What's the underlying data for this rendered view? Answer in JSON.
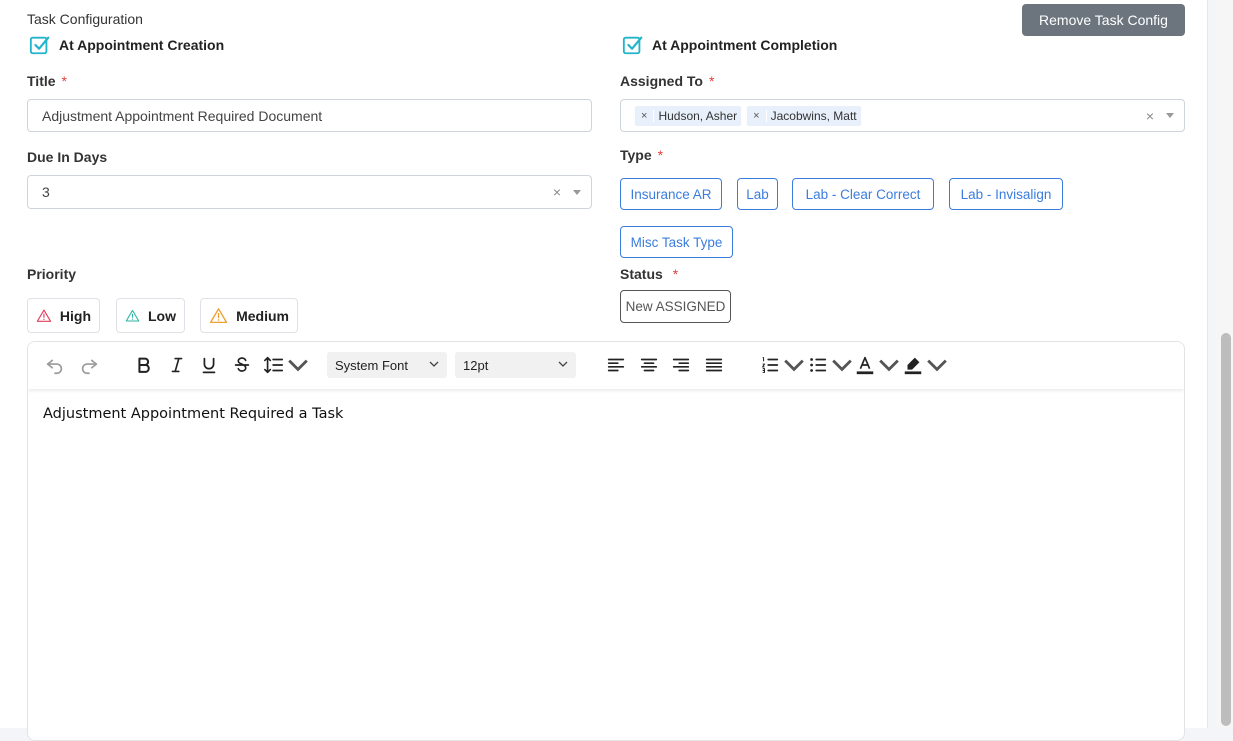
{
  "section_title": "Task Configuration",
  "remove_button": "Remove Task Config",
  "checkbox_creation": "At Appointment Creation",
  "checkbox_completion": "At Appointment Completion",
  "title_label": "Title",
  "title_value": "Adjustment Appointment Required Document",
  "assigned_label": "Assigned To",
  "assigned_tags": [
    "Hudson, Asher",
    "Jacobwins, Matt"
  ],
  "due_label": "Due In Days",
  "due_value": "3",
  "type_label": "Type",
  "type_options": [
    "Insurance AR",
    "Lab",
    "Lab - Clear Correct",
    "Lab - Invisalign",
    "Misc Task Type"
  ],
  "priority_label": "Priority",
  "priority_options": [
    "High",
    "Low",
    "Medium"
  ],
  "status_label": "Status",
  "status_value": "New ASSIGNED",
  "required_mark": "*",
  "clear_symbol": "×",
  "editor": {
    "font_family": "System Font",
    "font_size": "12pt",
    "content": "Adjustment Appointment Required a Task"
  },
  "colors": {
    "accent": "#3b7ddd",
    "checkbox": "#22b5c9",
    "high": "#e53e5c",
    "low": "#2bb3a3",
    "medium": "#f0a030",
    "remove_btn": "#6c757d"
  }
}
